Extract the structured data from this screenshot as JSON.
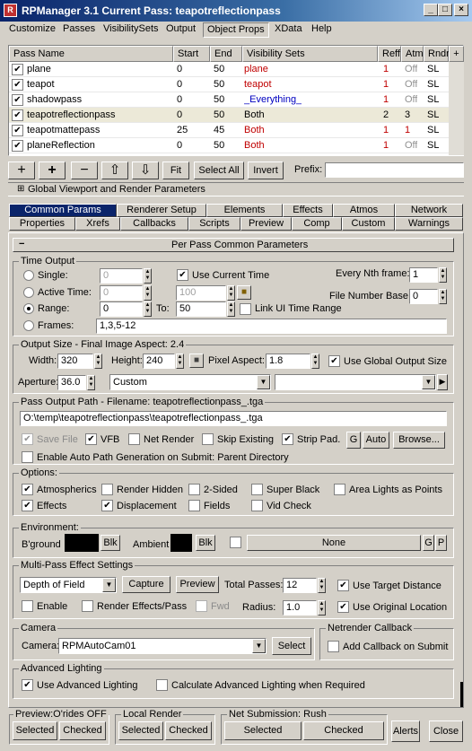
{
  "window": {
    "title": "RPManager 3.1   Current Pass: teapotreflectionpass",
    "icon": "rpmanager-icon",
    "buttons": [
      "_",
      "□",
      "×"
    ]
  },
  "menu": [
    "Customize",
    "Passes",
    "VisibilitySets",
    "Output",
    "Object Props",
    "XData",
    "Help"
  ],
  "grid": {
    "headers": [
      "Pass Name",
      "Start",
      "End",
      "Visibility Sets",
      "Reff",
      "Atm",
      "Rndr",
      "+"
    ],
    "rows": [
      {
        "checked": "✔",
        "name": "plane",
        "start": "0",
        "end": "50",
        "vis": "plane",
        "reff": "1",
        "atm": "Off",
        "rndr": "SL"
      },
      {
        "checked": "✔",
        "name": "teapot",
        "start": "0",
        "end": "50",
        "vis": "teapot",
        "reff": "1",
        "atm": "Off",
        "rndr": "SL"
      },
      {
        "checked": "✔",
        "name": "shadowpass",
        "start": "0",
        "end": "50",
        "vis": "_Everything_",
        "reff": "1",
        "atm": "Off",
        "rndr": "SL"
      },
      {
        "checked": "✔",
        "name": "teapotreflectionpass",
        "start": "0",
        "end": "50",
        "vis": "Both",
        "reff": "2",
        "atm": "3",
        "rndr": "SL"
      },
      {
        "checked": "✔",
        "name": "teapotmattepass",
        "start": "25",
        "end": "45",
        "vis": "Both",
        "reff": "1",
        "atm": "1",
        "rndr": "SL"
      },
      {
        "checked": "✔",
        "name": "planeReflection",
        "start": "0",
        "end": "50",
        "vis": "Both",
        "reff": "1",
        "atm": "Off",
        "rndr": "SL"
      }
    ]
  },
  "toolbar": {
    "add": "+",
    "add2": "+",
    "remove": "−",
    "up": "⇧",
    "down": "⇩",
    "fit": "Fit",
    "select_all": "Select All",
    "invert": "Invert",
    "prefix_label": "Prefix:",
    "prefix_value": ""
  },
  "global_rollout": {
    "toggle": "⊞",
    "label": "Global Viewport and Render Parameters"
  },
  "tabs_row1": [
    "Common Params",
    "Renderer Setup",
    "Elements",
    "Effects",
    "Atmos",
    "Network"
  ],
  "tabs_row2": [
    "Properties",
    "Xrefs",
    "Callbacks",
    "Scripts",
    "Preview",
    "Comp",
    "Custom",
    "Warnings"
  ],
  "rollout": {
    "toggle": "−",
    "title": "Per Pass Common Parameters"
  },
  "time_output": {
    "title": "Time Output",
    "single": "Single:",
    "single_value": "0",
    "use_current_time": "Use Current Time",
    "every_nth": "Every Nth frame:",
    "every_nth_value": "1",
    "active_time": "Active Time:",
    "active_from": "0",
    "active_to": "100",
    "file_number_base": "File Number Base:",
    "file_number_value": "0",
    "range": "Range:",
    "range_from": "0",
    "to": "To:",
    "range_to": "50",
    "link_ui": "Link UI Time Range",
    "frames": "Frames:",
    "frames_value": "1,3,5-12"
  },
  "output_size": {
    "title": "Output Size - Final Image Aspect: 2.4",
    "width_label": "Width:",
    "width": "320",
    "height_label": "Height:",
    "height": "240",
    "pixel_aspect_label": "Pixel Aspect:",
    "pixel_aspect": "1.8",
    "use_global": "Use Global Output Size",
    "aperture_label": "Aperture:",
    "aperture": "36.0",
    "preset": "Custom"
  },
  "output_path": {
    "title": "Pass Output Path - Filename: teapotreflectionpass_.tga",
    "path": "O:\\temp\\teapotreflectionpass\\teapotreflectionpass_.tga",
    "save_file": "Save File",
    "vfb": "VFB",
    "net_render": "Net Render",
    "skip_existing": "Skip Existing",
    "strip_pad": "Strip Pad.",
    "g": "G",
    "auto": "Auto",
    "browse": "Browse...",
    "auto_path": "Enable Auto Path Generation on Submit: Parent Directory"
  },
  "options": {
    "title": "Options:",
    "atmospherics": "Atmospherics",
    "render_hidden": "Render Hidden",
    "two_sided": "2-Sided",
    "super_black": "Super Black",
    "area_lights": "Area Lights as Points",
    "effects": "Effects",
    "displacement": "Displacement",
    "fields": "Fields",
    "vid_check": "Vid Check"
  },
  "environment": {
    "title": "Environment:",
    "bground": "B'ground",
    "blk": "Blk",
    "ambient": "Ambient",
    "blk2": "Blk",
    "map": "None",
    "g": "G",
    "p": "P",
    "bground_color": "#000000",
    "ambient_color": "#000000"
  },
  "multipass": {
    "title": "Multi-Pass Effect Settings",
    "effect": "Depth of Field",
    "capture": "Capture",
    "preview": "Preview",
    "total_passes_label": "Total Passes:",
    "total_passes": "12",
    "use_target_distance": "Use Target Distance",
    "enable": "Enable",
    "render_effects": "Render Effects/Pass",
    "fwd": "Fwd",
    "radius_label": "Radius:",
    "radius": "1.0",
    "use_original_location": "Use Original Location"
  },
  "camera": {
    "title": "Camera",
    "label": "Camera:",
    "value": "RPMAutoCam01",
    "select": "Select"
  },
  "netrender_callback": {
    "title": "Netrender Callback",
    "add": "Add Callback on Submit"
  },
  "advanced_lighting": {
    "title": "Advanced Lighting",
    "use": "Use Advanced Lighting",
    "calculate": "Calculate Advanced Lighting when Required"
  },
  "bottom": {
    "preview_title": "Preview:O'rides OFF",
    "preview_selected": "Selected",
    "preview_checked": "Checked",
    "local_title": "Local Render",
    "local_selected": "Selected",
    "local_checked": "Checked",
    "net_title": "Net Submission: Rush",
    "net_selected": "Selected",
    "net_checked": "Checked",
    "alerts": "Alerts",
    "close": "Close"
  },
  "colors": {
    "title_blue": "#0a246a",
    "vis_red": "#c00000",
    "vis_blue": "#0000c0",
    "reff_red": "#c00000",
    "off_gray": "#909090",
    "selected_row": "#ece9d8"
  }
}
